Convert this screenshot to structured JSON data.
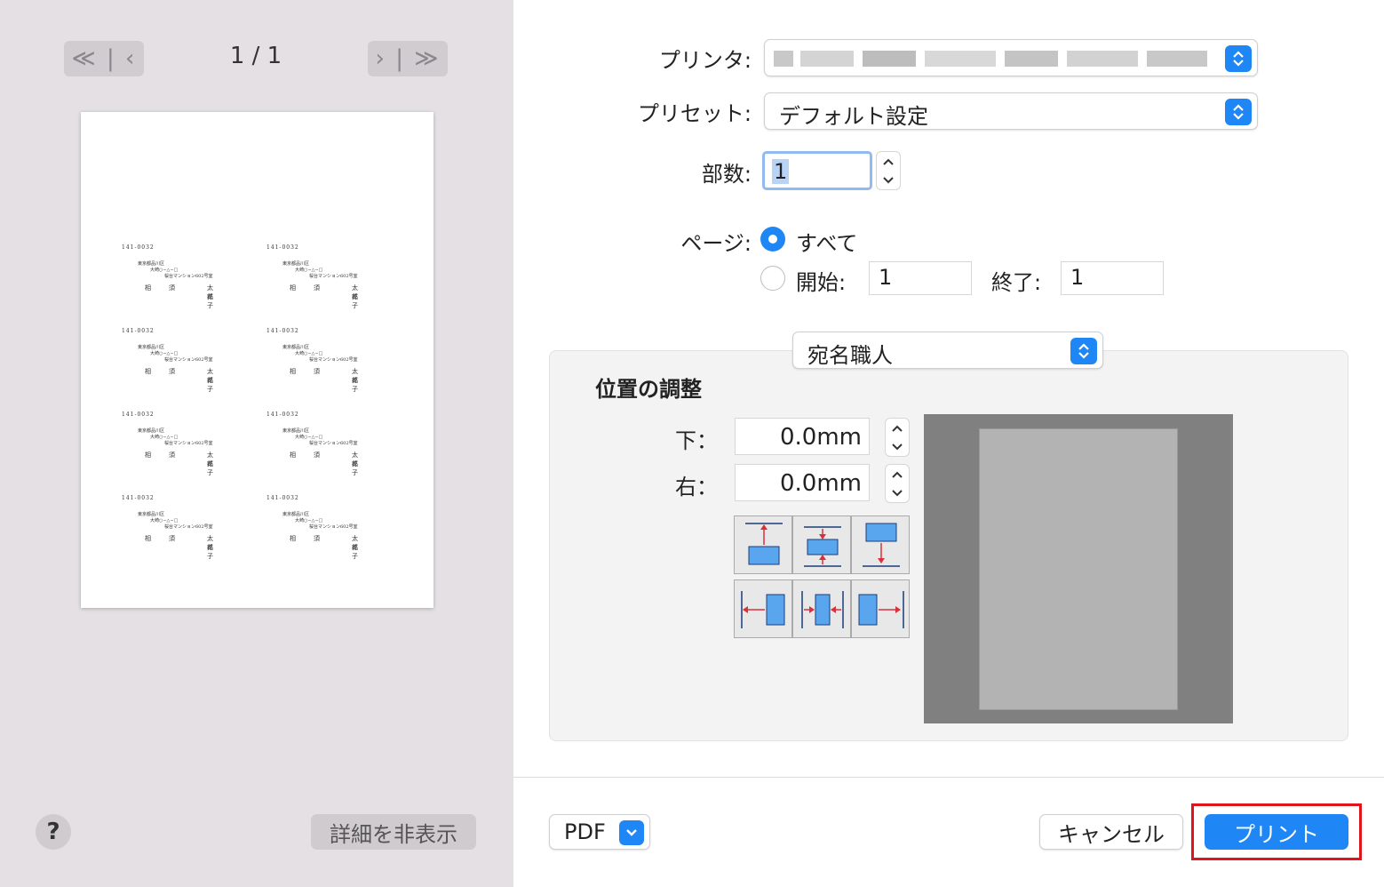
{
  "window": {
    "border_color": "#d0d0d0"
  },
  "preview": {
    "prev_nav_icon": "double-chevron-left-icon",
    "next_nav_icon": "double-chevron-right-icon",
    "prev_label": "≪ | ‹",
    "next_label": "› | ≫",
    "page_indicator": "1 / 1",
    "labels": [
      {
        "zip": "141-0032",
        "addr1": "東京都品川区",
        "addr2": "大崎○−△−□",
        "addr3": "桜台マンション602号室",
        "surname": "相須",
        "name1": "太郎",
        "name2": "花子"
      },
      {
        "zip": "141-0032",
        "addr1": "東京都品川区",
        "addr2": "大崎○−△−□",
        "addr3": "桜台マンション602号室",
        "surname": "相須",
        "name1": "太郎",
        "name2": "花子"
      },
      {
        "zip": "141-0032",
        "addr1": "東京都品川区",
        "addr2": "大崎○−△−□",
        "addr3": "桜台マンション602号室",
        "surname": "相須",
        "name1": "太郎",
        "name2": "花子"
      },
      {
        "zip": "141-0032",
        "addr1": "東京都品川区",
        "addr2": "大崎○−△−□",
        "addr3": "桜台マンション602号室",
        "surname": "相須",
        "name1": "太郎",
        "name2": "花子"
      },
      {
        "zip": "141-0032",
        "addr1": "東京都品川区",
        "addr2": "大崎○−△−□",
        "addr3": "桜台マンション602号室",
        "surname": "相須",
        "name1": "太郎",
        "name2": "花子"
      },
      {
        "zip": "141-0032",
        "addr1": "東京都品川区",
        "addr2": "大崎○−△−□",
        "addr3": "桜台マンション602号室",
        "surname": "相須",
        "name1": "太郎",
        "name2": "花子"
      },
      {
        "zip": "141-0032",
        "addr1": "東京都品川区",
        "addr2": "大崎○−△−□",
        "addr3": "桜台マンション602号室",
        "surname": "相須",
        "name1": "太郎",
        "name2": "花子"
      },
      {
        "zip": "141-0032",
        "addr1": "東京都品川区",
        "addr2": "大崎○−△−□",
        "addr3": "桜台マンション602号室",
        "surname": "相須",
        "name1": "太郎",
        "name2": "花子"
      }
    ],
    "help_label": "?",
    "hide_details_label": "詳細を非表示"
  },
  "settings": {
    "printer_label": "プリンタ:",
    "printer_value_obscured": true,
    "preset_label": "プリセット:",
    "preset_value": "デフォルト設定",
    "copies_label": "部数:",
    "copies_value": "1",
    "pages_label": "ページ:",
    "pages_all_label": "すべて",
    "pages_all_selected": true,
    "pages_from_label": "開始:",
    "pages_from_value": "1",
    "pages_to_label": "終了:",
    "pages_to_value": "1",
    "app_section_value": "宛名職人"
  },
  "position_adjust": {
    "title": "位置の調整",
    "bottom_label": "下：",
    "bottom_value": "0.0mm",
    "right_label": "右：",
    "right_value": "0.0mm",
    "align_buttons": [
      "align-top-icon",
      "align-vcenter-icon",
      "align-bottom-icon",
      "align-left-icon",
      "align-hcenter-icon",
      "align-right-icon"
    ]
  },
  "footer": {
    "pdf_label": "PDF",
    "cancel_label": "キャンセル",
    "print_label": "プリント",
    "highlight_color": "#e0141c",
    "accent_color": "#1f86f5"
  }
}
